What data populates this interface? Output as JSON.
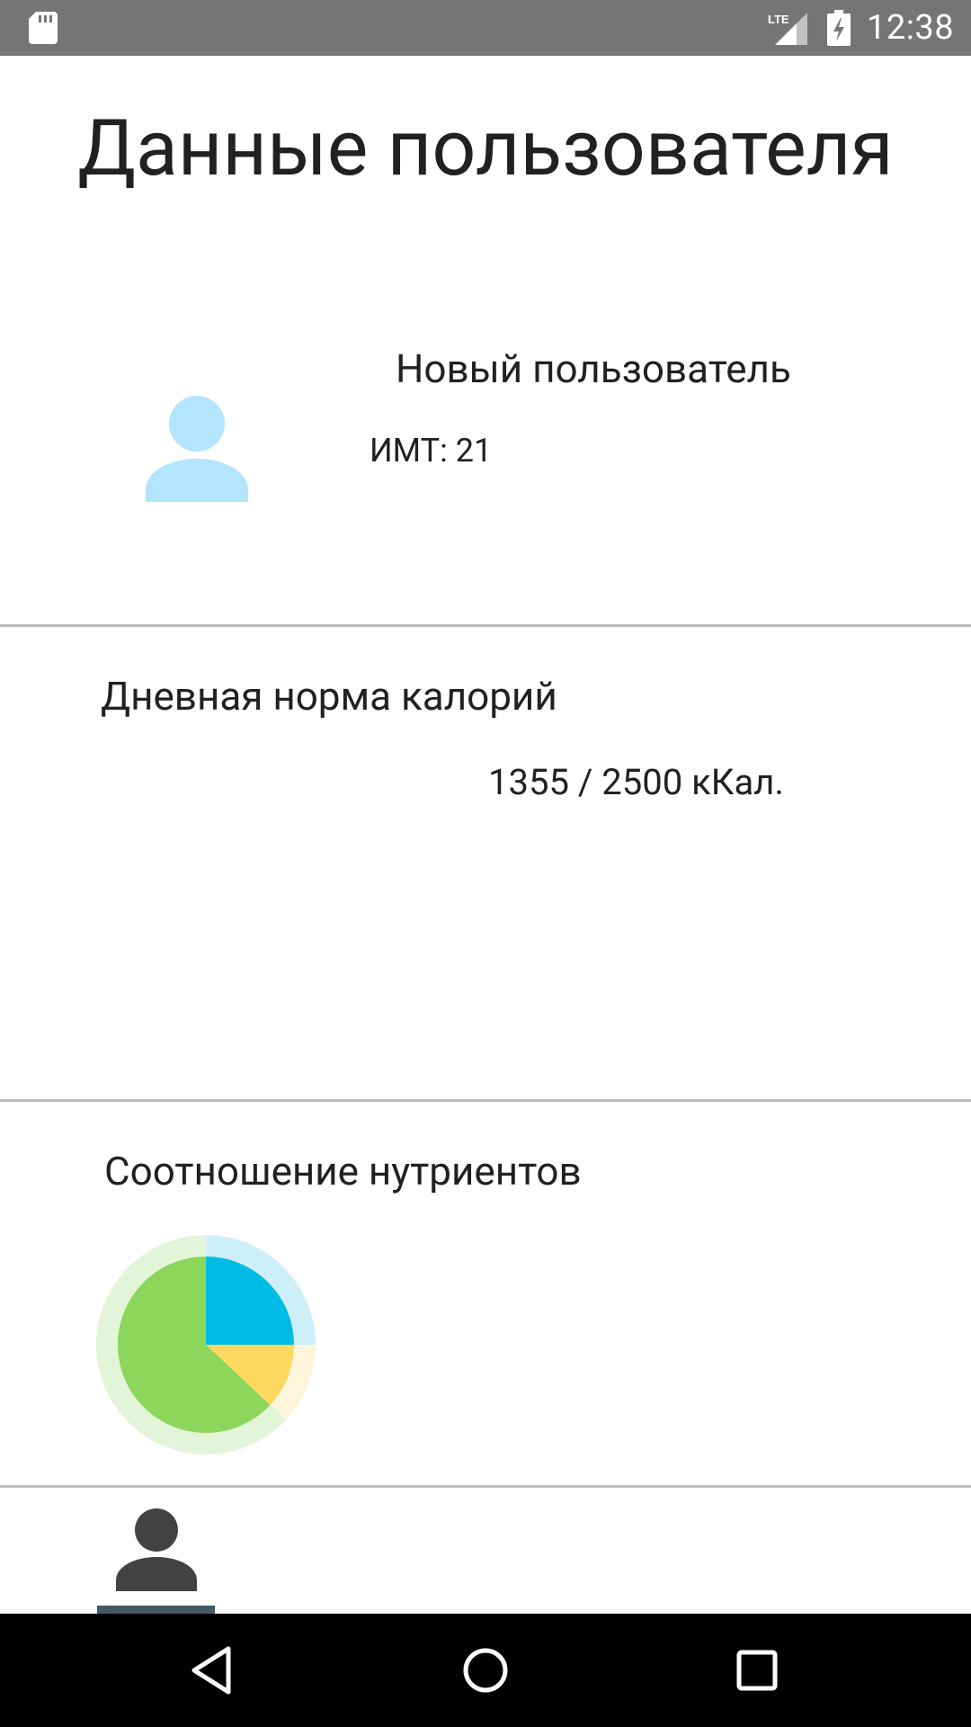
{
  "status_bar": {
    "time": "12:38",
    "network": "LTE",
    "icons": [
      "sd-card-icon",
      "lte-signal-icon",
      "battery-charging-icon"
    ]
  },
  "page": {
    "title": "Данные пользователя"
  },
  "profile": {
    "name": "Новый пользователь",
    "bmi": "ИМТ: 21",
    "avatar_color": "#b3e5fc"
  },
  "calories": {
    "title": "Дневная норма калорий",
    "value": "1355 / 2500 кКал.",
    "consumed": 1355,
    "goal": 2500
  },
  "nutrients": {
    "title": "Соотношение нутриентов"
  },
  "chart_data": {
    "type": "pie",
    "values": [
      25,
      12,
      63
    ],
    "colors": [
      "#00bce5",
      "#ffd95f",
      "#8bd65b"
    ],
    "ring_colors": [
      "#cdeff8",
      "#fdf6dc",
      "#e3f5d9"
    ]
  },
  "bottom_nav": {
    "items": [
      {
        "icon": "person-icon",
        "active": true
      }
    ],
    "active_color": "#455a64",
    "icon_color": "#424242"
  },
  "system_nav": {
    "icons": [
      "back-icon",
      "home-icon",
      "recents-icon"
    ]
  }
}
